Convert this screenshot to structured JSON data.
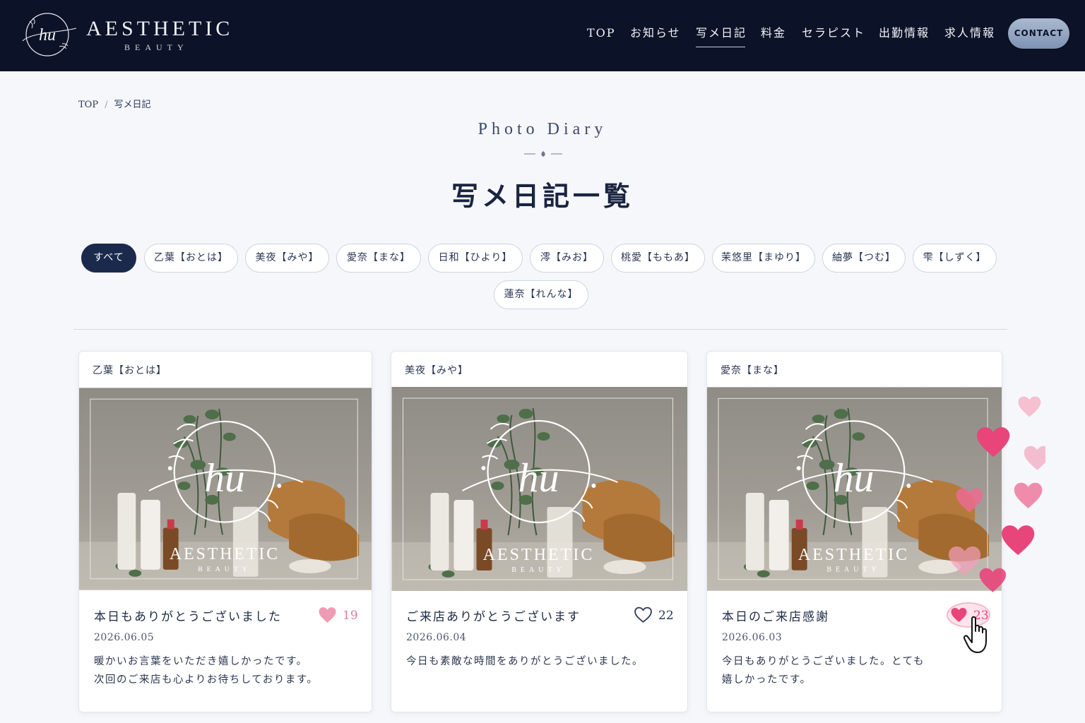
{
  "brand": {
    "emblem_text": "hu",
    "name": "AESTHETIC",
    "sub": "BEAUTY"
  },
  "nav": {
    "items": [
      "TOP",
      "お知らせ",
      "写メ日記",
      "料金",
      "セラピスト",
      "出勤情報",
      "求人情報"
    ],
    "active": "写メ日記",
    "contact_label": "CONTACT"
  },
  "breadcrumb": {
    "home": "TOP",
    "separator": "/",
    "current": "写メ日記"
  },
  "heading": {
    "subtitle": "Photo Diary",
    "title": "写メ日記一覧"
  },
  "filters": {
    "items": [
      "すべて",
      "乙葉【おとは】",
      "美夜【みや】",
      "愛奈【まな】",
      "日和【ひより】",
      "澪【みお】",
      "桃愛【ももあ】",
      "茉悠里【まゆり】",
      "紬夢【つむ】",
      "雫【しずく】",
      "蓮奈【れんな】"
    ],
    "active": "すべて"
  },
  "posts": [
    {
      "therapist": "乙葉【おとは】",
      "title": "本日もありがとうございました",
      "likes": "19",
      "liked": true,
      "date": "2026.06.05",
      "text": [
        "暖かいお言葉をいただき嬉しかったです。",
        "次回のご来店も心よりお待ちしております。"
      ]
    },
    {
      "therapist": "美夜【みや】",
      "title": "ご来店ありがとうございます",
      "likes": "22",
      "liked": false,
      "date": "2026.06.04",
      "text": [
        "今日も素敵な時間をありがとうございました。"
      ]
    },
    {
      "therapist": "愛奈【まな】",
      "title": "本日のご来店感謝",
      "likes": "23",
      "liked": true,
      "date": "2026.06.03",
      "text": [
        "今日もありがとうございました。とても",
        "嬉しかったです。"
      ]
    }
  ],
  "photo_logo": {
    "emblem_text": "hu",
    "name": "AESTHETIC",
    "sub": "BEAUTY"
  },
  "colors": {
    "header_bg": "#0c1328",
    "accent_navy": "#1b2a4c",
    "heart_pink": "#e8457a",
    "heart_light": "#f3a0ba"
  }
}
